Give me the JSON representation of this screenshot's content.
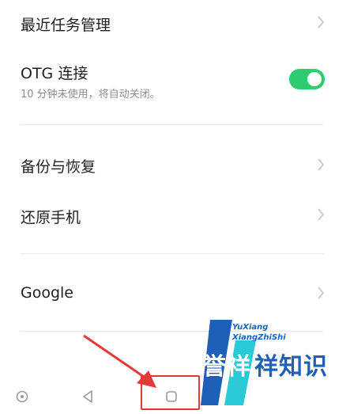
{
  "colors": {
    "accent": "#2ecc71",
    "chevron": "#c8c8c8",
    "annotation": "#e53935",
    "watermark_blue": "#1e5fb8",
    "watermark_cyan": "#29c9d6"
  },
  "settings": {
    "recent_tasks": {
      "label": "最近任务管理",
      "icon": "chevron-right-icon"
    },
    "otg": {
      "label": "OTG 连接",
      "sublabel": "10 分钟未使用，将自动关闭。",
      "toggle_on": true
    },
    "backup": {
      "label": "备份与恢复",
      "icon": "chevron-right-icon"
    },
    "reset": {
      "label": "还原手机",
      "icon": "chevron-right-icon"
    },
    "google": {
      "label": "Google",
      "icon": "chevron-right-icon"
    }
  },
  "navbar": {
    "buttons": [
      {
        "name": "assistant-button",
        "icon": "circle-dot-icon"
      },
      {
        "name": "back-button",
        "icon": "triangle-back-icon"
      },
      {
        "name": "home-button",
        "icon": "rounded-square-icon"
      }
    ]
  },
  "watermark": {
    "line1": "YuXiang",
    "line2": "XiangZhiShi",
    "brand": "誉祥",
    "brand_rest": "祥知识"
  }
}
